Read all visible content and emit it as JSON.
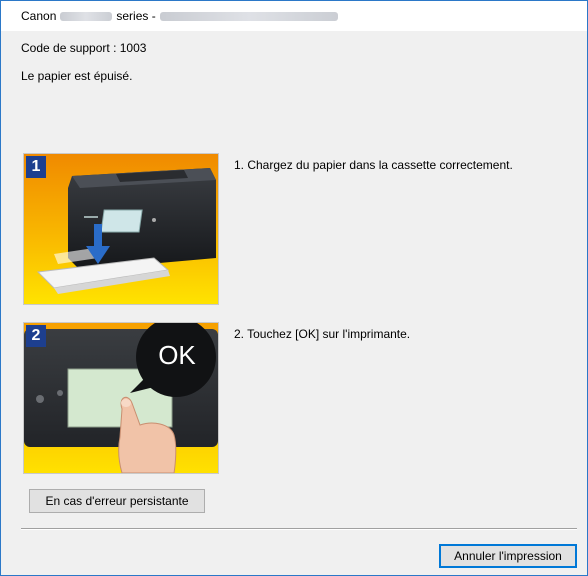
{
  "window": {
    "title_prefix": "Canon",
    "title_middle": "series -"
  },
  "message": {
    "support_code": "Code de support : 1003",
    "description": "Le papier est épuisé."
  },
  "steps": [
    {
      "number": "1",
      "text": "1.  Chargez du papier dans la cassette correctement."
    },
    {
      "number": "2",
      "text": "2.  Touchez [OK] sur l'imprimante.",
      "badge": "OK"
    }
  ],
  "buttons": {
    "persistent_error": "En cas d'erreur persistante",
    "cancel_print": "Annuler l'impression"
  },
  "colors": {
    "accent": "#0078d7",
    "badge_blue": "#1d3f8f",
    "illustration_orange": "#f6a300",
    "illustration_yellow": "#ffe100"
  }
}
